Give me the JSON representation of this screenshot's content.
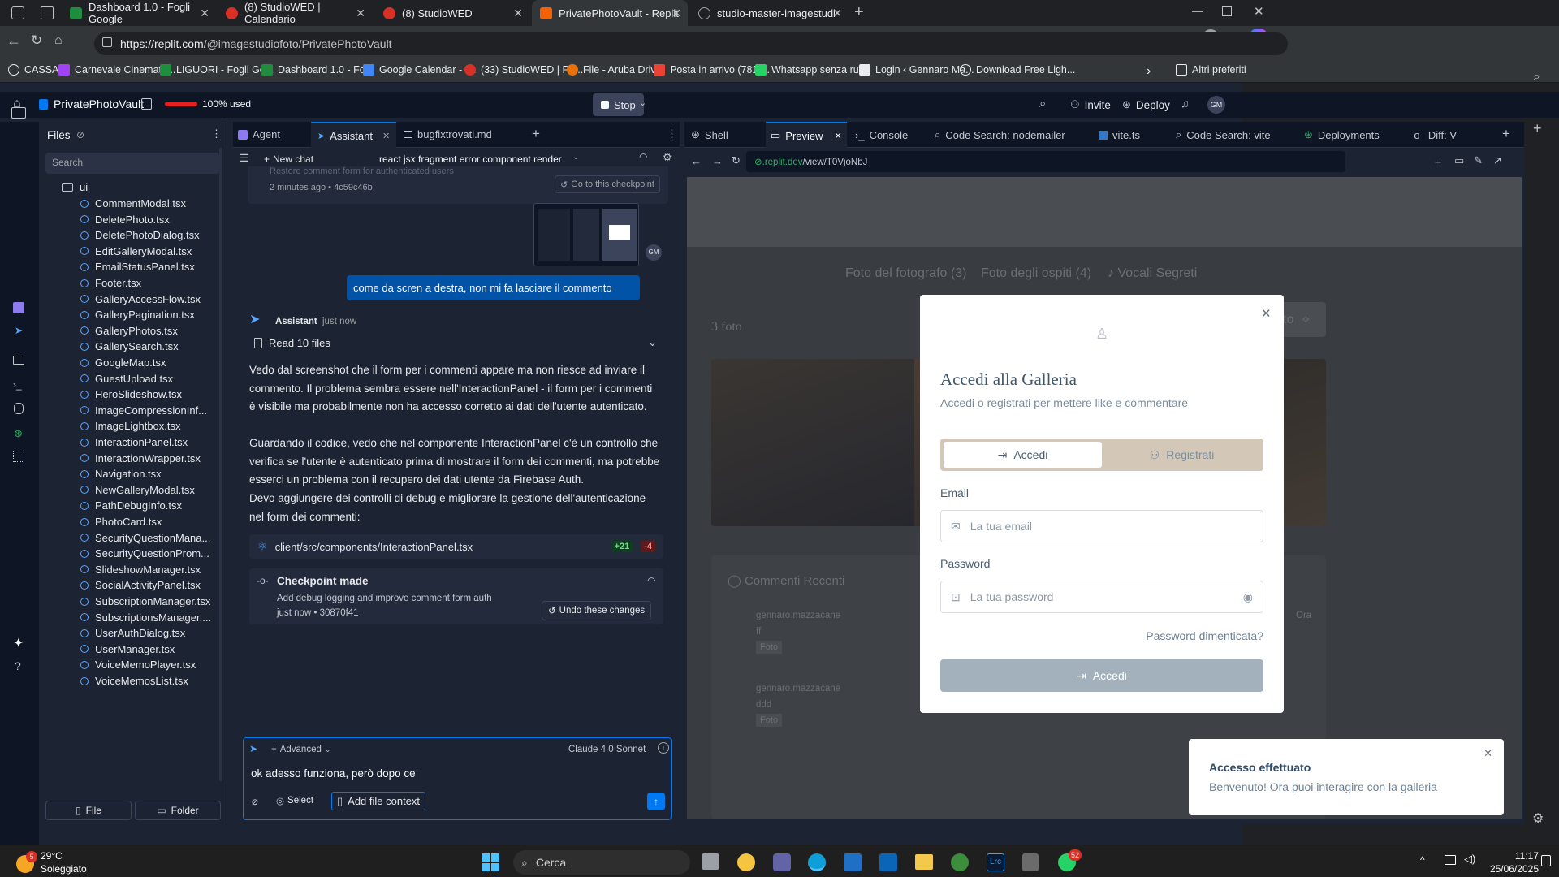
{
  "browser": {
    "tabs": [
      {
        "label": "Dashboard 1.0 - Fogli Google",
        "color": "#1e8e3e"
      },
      {
        "label": "(8) StudioWED | Calendario",
        "color": "#d93025"
      },
      {
        "label": "(8) StudioWED",
        "color": "#d93025"
      },
      {
        "label": "PrivatePhotoVault - Replit",
        "color": "#f26207"
      },
      {
        "label": "studio-master-imagestudiofoto.r",
        "color": "#9aa0a6"
      }
    ],
    "url_host": "https://replit.com",
    "url_path": "/@imagestudiofoto/PrivatePhotoVault",
    "bookmarks": [
      "CASSA",
      "Carnevale Cinemato...",
      "LIGUORI - Fogli Go...",
      "Dashboard 1.0 - Fo...",
      "Google Calendar - f...",
      "(33) StudioWED | Pa...",
      "File - Aruba Drive",
      "Posta in arrivo (781)...",
      "Whatsapp senza ru...",
      "Login ‹ Gennaro Ma...",
      "Download Free Ligh..."
    ],
    "other_bookmarks": "Altri preferiti"
  },
  "replit": {
    "project": "PrivatePhotoVault",
    "usage": "100% used",
    "stop": "Stop",
    "invite": "Invite",
    "deploy": "Deploy",
    "avatar": "GM"
  },
  "files": {
    "title": "Files",
    "search_placeholder": "Search",
    "folder": "ui",
    "items": [
      "CommentModal.tsx",
      "DeletePhoto.tsx",
      "DeletePhotoDialog.tsx",
      "EditGalleryModal.tsx",
      "EmailStatusPanel.tsx",
      "Footer.tsx",
      "GalleryAccessFlow.tsx",
      "GalleryPagination.tsx",
      "GalleryPhotos.tsx",
      "GallerySearch.tsx",
      "GoogleMap.tsx",
      "GuestUpload.tsx",
      "HeroSlideshow.tsx",
      "ImageCompressionInf...",
      "ImageLightbox.tsx",
      "InteractionPanel.tsx",
      "InteractionWrapper.tsx",
      "Navigation.tsx",
      "NewGalleryModal.tsx",
      "PathDebugInfo.tsx",
      "PhotoCard.tsx",
      "SecurityQuestionMana...",
      "SecurityQuestionProm...",
      "SlideshowManager.tsx",
      "SocialActivityPanel.tsx",
      "SubscriptionManager.tsx",
      "SubscriptionsManager....",
      "UserAuthDialog.tsx",
      "UserManager.tsx",
      "VoiceMemoPlayer.tsx",
      "VoiceMemosList.tsx"
    ],
    "new_file": "File",
    "new_folder": "Folder"
  },
  "chat": {
    "tabs": [
      "Agent",
      "Assistant",
      "bugfixtrovati.md"
    ],
    "new_chat": "New chat",
    "thread_title": "react jsx fragment error component render",
    "faded_line": "Restore comment form for authenticated users",
    "top_time": "2 minutes ago",
    "top_hash": "• 4c59c46b",
    "goto_checkpoint": "Go to this checkpoint",
    "user_avatar": "GM",
    "user_message": "come da scren a destra, non mi fa lasciare il commento",
    "assistant_name": "Assistant",
    "assistant_time": "just now",
    "read_files": "Read 10 files",
    "p1": "Vedo dal screenshot che il form per i commenti appare ma non riesce ad inviare il commento. Il problema sembra essere nell'InteractionPanel - il form per i commenti è visibile ma probabilmente non ha accesso corretto ai dati dell'utente autenticato.",
    "p2": "Guardando il codice, vedo che nel componente InteractionPanel c'è un controllo che verifica se l'utente è autenticato prima di mostrare il form dei commenti, ma potrebbe esserci un problema con il recupero dei dati utente da Firebase Auth.",
    "p3": "Devo aggiungere dei controlli di debug e migliorare la gestione dell'autenticazione nel form dei commenti:",
    "file_change": "client/src/components/InteractionPanel.tsx",
    "added": "+21",
    "removed": "-4",
    "checkpoint_title": "Checkpoint made",
    "checkpoint_desc": "Add debug logging and improve comment form auth",
    "checkpoint_time": "just now",
    "checkpoint_hash": "• 30870f41",
    "undo": "Undo these changes",
    "advanced": "Advanced",
    "model": "Claude 4.0 Sonnet",
    "input_value": "ok adesso funziona, però dopo ce",
    "select": "Select",
    "add_context": "Add file context"
  },
  "preview": {
    "tabs": [
      "Shell",
      "Preview",
      "Console",
      "Code Search: nodemailer",
      "vite.ts",
      "Code Search: vite",
      "Deployments",
      "Diff: V"
    ],
    "url_host": ".replit.dev",
    "url_path": "/view/T0VjoNbJ",
    "bg_tabs": [
      "Foto del fotografo (3)",
      "Foto degli ospiti (4)",
      "Vocali Segreti"
    ],
    "photo_count": "3 foto",
    "upload": "Carica foto",
    "comments_title": "Commenti Recenti",
    "comments": [
      {
        "author": "gennaro.mazzacane",
        "text": "ff",
        "tag": "Foto",
        "time": "Ora"
      },
      {
        "author": "gennaro.mazzacane",
        "text": "ddd",
        "tag": "Foto",
        "time": ""
      }
    ],
    "modal": {
      "title": "Accedi alla Galleria",
      "subtitle": "Accedi o registrati per mettere like e commentare",
      "tab_login": "Accedi",
      "tab_register": "Registrati",
      "email_label": "Email",
      "email_placeholder": "La tua email",
      "password_label": "Password",
      "password_placeholder": "La tua password",
      "forgot": "Password dimenticata?",
      "submit": "Accedi"
    },
    "toast": {
      "title": "Accesso effettuato",
      "body": "Benvenuto! Ora puoi interagire con la galleria"
    }
  },
  "taskbar": {
    "weather_temp": "29°C",
    "weather_desc": "Soleggiato",
    "weather_badge": "5",
    "search": "Cerca",
    "whatsapp_badge": "52",
    "time": "11:17",
    "date": "25/06/2025"
  }
}
